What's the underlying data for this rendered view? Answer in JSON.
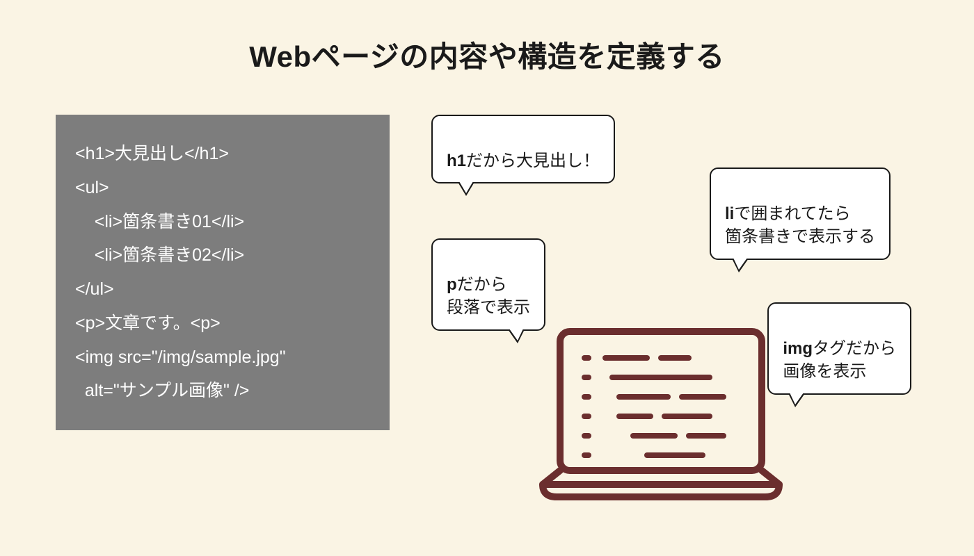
{
  "title": "Webページの内容や構造を定義する",
  "code": "<h1>大見出し</h1>\n<ul>\n    <li>箇条書き01</li>\n    <li>箇条書き02</li>\n</ul>\n<p>文章です。<p>\n<img src=\"/img/sample.jpg\"\n  alt=\"サンプル画像\" />",
  "bubbles": {
    "b1": {
      "bold": "h1",
      "rest": "だから大見出し！"
    },
    "b2": {
      "bold": "li",
      "rest": "で囲まれてたら\n箇条書きで表示する"
    },
    "b3": {
      "bold": "p",
      "rest": "だから\n段落で表示"
    },
    "b4": {
      "bold": "img",
      "rest": "タグだから\n画像を表示"
    }
  },
  "colors": {
    "bg": "#faf4e4",
    "codebg": "#7d7d7d",
    "laptop": "#6b2e2e"
  }
}
